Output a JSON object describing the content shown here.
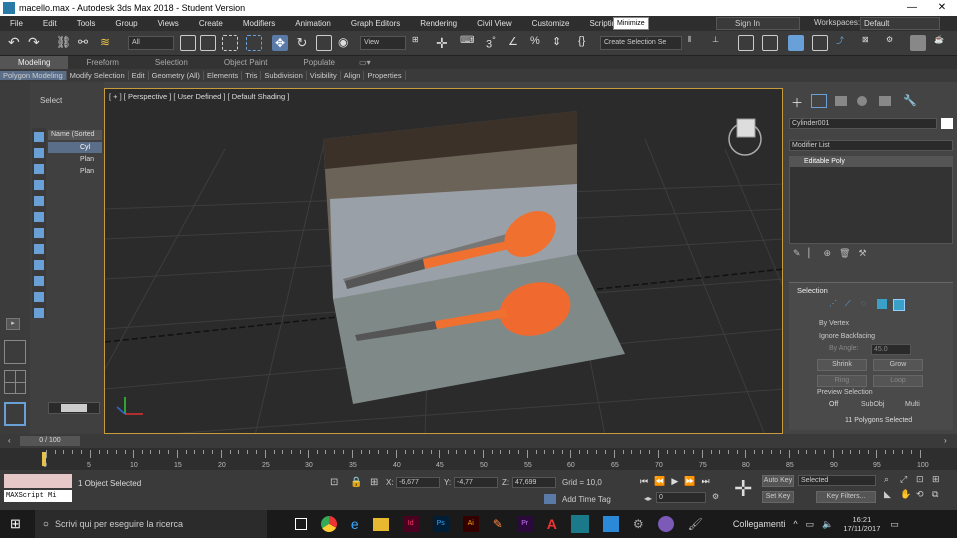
{
  "titlebar": {
    "title": "macello.max - Autodesk 3ds Max 2018 - Student Version",
    "minimize": "—",
    "close": "✕"
  },
  "menubar": {
    "items": [
      "File",
      "Edit",
      "Tools",
      "Group",
      "Views",
      "Create",
      "Modifiers",
      "Animation",
      "Graph Editors",
      "Rendering",
      "Civil View",
      "Customize",
      "Scripting"
    ],
    "tooltip": "Minimize",
    "signin": "Sign In",
    "workspaces_label": "Workspaces:",
    "workspaces_value": "Default"
  },
  "toolbar": {
    "filter": "All",
    "view": "View",
    "selection_set": "Create Selection Se"
  },
  "ribbon": {
    "tabs": [
      "Modeling",
      "Freeform",
      "Selection",
      "Object Paint",
      "Populate"
    ],
    "items": [
      "Polygon Modeling",
      "Modify Selection",
      "Edit",
      "Geometry (All)",
      "Elements",
      "Tris",
      "Subdivision",
      "Visibility",
      "Align",
      "Properties"
    ]
  },
  "explorer": {
    "select_label": "Select",
    "header": "Name (Sorted",
    "rows": [
      "Cyl",
      "Plan",
      "Plan"
    ]
  },
  "viewport": {
    "label": "[ + ] [ Perspective ] [ User Defined ] [ Default Shading ]"
  },
  "cmdpanel": {
    "object_name": "Cylinder001",
    "modifier_list": "Modifier List",
    "stack_item": "Editable Poly",
    "rollout_title": "Selection",
    "by_vertex": "By Vertex",
    "ignore_backfacing": "Ignore Backfacing",
    "by_angle": "By Angle:",
    "by_angle_value": "45.0",
    "shrink": "Shrink",
    "grow": "Grow",
    "ring": "Ring",
    "loop": "Loop",
    "preview_selection": "Preview Selection",
    "off": "Off",
    "subobj": "SubObj",
    "multi": "Multi",
    "selected_count": "11 Polygons Selected"
  },
  "timebar": {
    "frame": "0 / 100"
  },
  "timeline": {
    "ticks": [
      "0",
      "5",
      "10",
      "15",
      "20",
      "25",
      "30",
      "35",
      "40",
      "45",
      "50",
      "55",
      "60",
      "65",
      "70",
      "75",
      "80",
      "85",
      "90",
      "95",
      "100"
    ]
  },
  "status": {
    "maxscript": "MAXScript Mi",
    "selected": "1 Object Selected",
    "x_label": "X:",
    "x_value": "-6,677",
    "y_label": "Y:",
    "y_value": "-4,77",
    "z_label": "Z:",
    "z_value": "47,699",
    "grid": "Grid = 10,0",
    "add_time_tag": "Add Time Tag",
    "auto_key": "Auto Key",
    "set_key": "Set Key",
    "selected_dd": "Selected",
    "key_filters": "Key Filters...",
    "frame_value": "0"
  },
  "taskbar": {
    "search": "Scrivi qui per eseguire la ricerca",
    "tray_text": "Collegamenti",
    "time": "16:21",
    "date": "17/11/2017"
  }
}
